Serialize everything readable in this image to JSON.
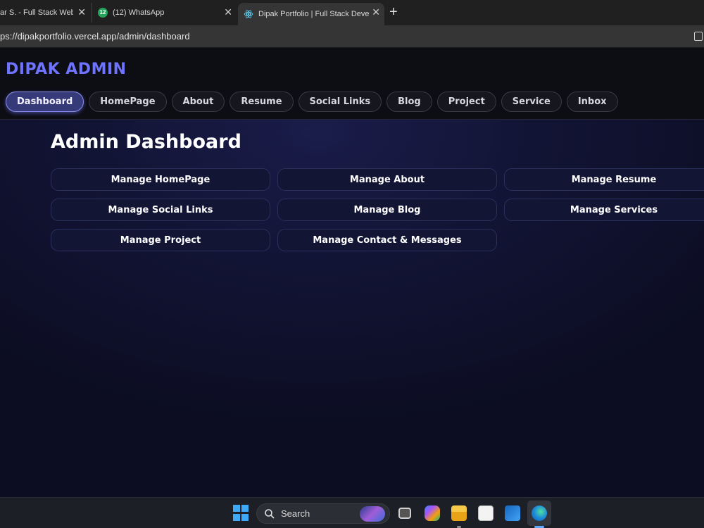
{
  "browser": {
    "tabs": [
      {
        "title": "ar S. - Full Stack Web Dev",
        "close": "✕"
      },
      {
        "badge": "12",
        "title": "(12) WhatsApp",
        "close": "✕"
      },
      {
        "title": "Dipak Portfolio | Full Stack Developer",
        "close": "✕",
        "active": true
      }
    ],
    "new_tab": "+",
    "url": "ps://dipakportfolio.vercel.app/admin/dashboard"
  },
  "app": {
    "brand": "DIPAK ADMIN",
    "nav": [
      "Dashboard",
      "HomePage",
      "About",
      "Resume",
      "Social Links",
      "Blog",
      "Project",
      "Service",
      "Inbox"
    ],
    "active_nav": "Dashboard",
    "heading": "Admin Dashboard",
    "cards": [
      "Manage HomePage",
      "Manage About",
      "Manage Resume",
      "Manage Social Links",
      "Manage Blog",
      "Manage Services",
      "Manage Project",
      "Manage Contact & Messages"
    ]
  },
  "taskbar": {
    "search_placeholder": "Search",
    "icons": [
      "windows-start-icon",
      "search-icon",
      "task-view-icon",
      "copilot-icon",
      "file-explorer-icon",
      "microsoft-store-icon",
      "outlook-icon",
      "edge-icon"
    ]
  },
  "colors": {
    "brand": "#6f74ff",
    "active_nav_bg": "#373a78",
    "page_bg": "#121435"
  }
}
